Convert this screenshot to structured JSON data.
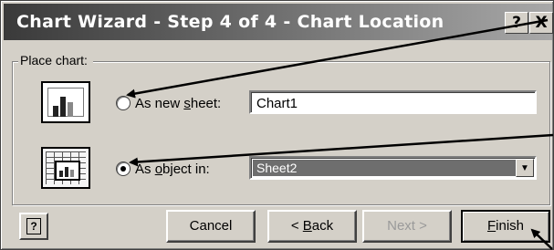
{
  "window": {
    "title": "Chart Wizard - Step 4 of 4 - Chart Location",
    "help_button": "?",
    "close_button": "X"
  },
  "group": {
    "label": "Place chart:"
  },
  "options": [
    {
      "label_prefix": "As new ",
      "label_key": "s",
      "label_suffix": "heet:",
      "value": "Chart1",
      "selected": false,
      "icon": "chart-sheet-icon"
    },
    {
      "label_prefix": "As ",
      "label_key": "o",
      "label_suffix": "bject in:",
      "value": "Sheet2",
      "selected": true,
      "icon": "embedded-chart-icon"
    }
  ],
  "buttons": {
    "help_icon": "?",
    "cancel": "Cancel",
    "back_prefix": "< ",
    "back_key": "B",
    "back_suffix": "ack",
    "next": "Next >",
    "finish_key": "F",
    "finish_suffix": "inish"
  },
  "colors": {
    "dialog_face": "#d4d0c8",
    "annotation_arrow": "#000000"
  }
}
